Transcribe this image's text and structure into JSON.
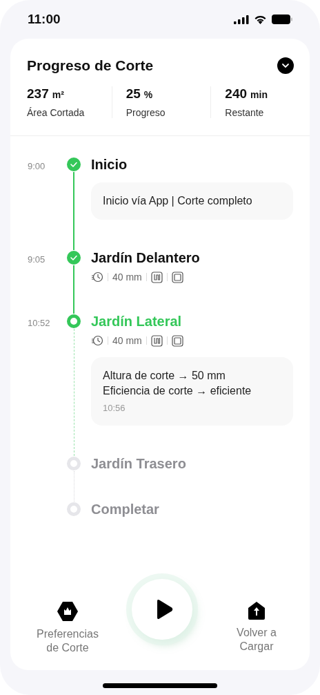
{
  "status_bar": {
    "time": "11:00"
  },
  "header": {
    "title": "Progreso de Corte",
    "expanded": false
  },
  "stats": [
    {
      "value": "237",
      "unit": "m²",
      "label": "Área Cortada"
    },
    {
      "value": "25",
      "unit": "%",
      "label": "Progreso"
    },
    {
      "value": "240",
      "unit": "min",
      "label": "Restante"
    }
  ],
  "timeline": [
    {
      "time": "9:00",
      "title": "Inicio",
      "done": true,
      "active": false,
      "note": {
        "lines": [
          "Inicio vía App | Corte completo"
        ]
      }
    },
    {
      "time": "9:05",
      "title": "Jardín Delantero",
      "done": true,
      "active": false,
      "meta": {
        "height": "40 mm"
      }
    },
    {
      "time": "10:52",
      "title": "Jardín Lateral",
      "done": false,
      "active": true,
      "meta": {
        "height": "40 mm"
      },
      "note": {
        "lines": [
          "Altura de corte → 50 mm",
          "Eficiencia de corte → eficiente"
        ],
        "time": "10:56"
      }
    },
    {
      "title": "Jardín Trasero",
      "done": false,
      "active": false
    },
    {
      "title": "Completar",
      "done": false,
      "active": false
    }
  ],
  "bottom_bar": [
    {
      "kind": "preferences",
      "label": "Preferencias\nde Corte"
    },
    {
      "kind": "play"
    },
    {
      "kind": "recharge",
      "label": "Volver a\nCargar"
    }
  ]
}
